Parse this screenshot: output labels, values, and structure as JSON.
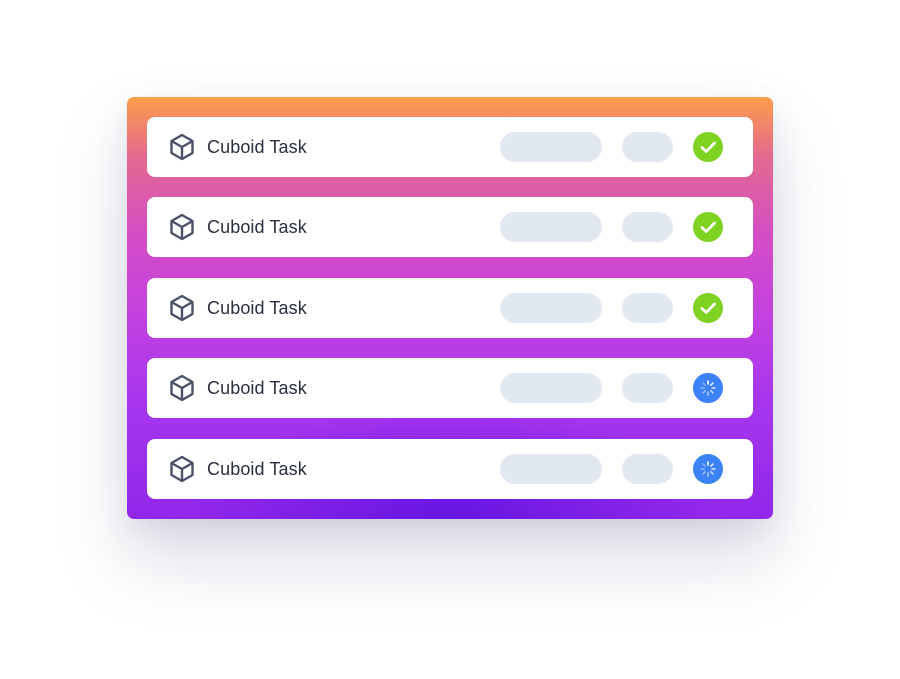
{
  "colors": {
    "panel_gradient_top": "#fe9d4a",
    "panel_gradient_mid": "#d44dc6",
    "panel_gradient_bottom": "#9127ea",
    "row_background": "#ffffff",
    "placeholder_pill": "#e2e8f0",
    "status_done": "#7ed321",
    "status_pending": "#3b82f6",
    "text": "#2b3040"
  },
  "tasks": [
    {
      "label": "Cuboid Task",
      "icon": "cube-icon",
      "status": "done",
      "status_icon": "check-icon"
    },
    {
      "label": "Cuboid Task",
      "icon": "cube-icon",
      "status": "done",
      "status_icon": "check-icon"
    },
    {
      "label": "Cuboid Task",
      "icon": "cube-icon",
      "status": "done",
      "status_icon": "check-icon"
    },
    {
      "label": "Cuboid Task",
      "icon": "cube-icon",
      "status": "pending",
      "status_icon": "spinner-icon"
    },
    {
      "label": "Cuboid Task",
      "icon": "cube-icon",
      "status": "pending",
      "status_icon": "spinner-icon"
    }
  ]
}
